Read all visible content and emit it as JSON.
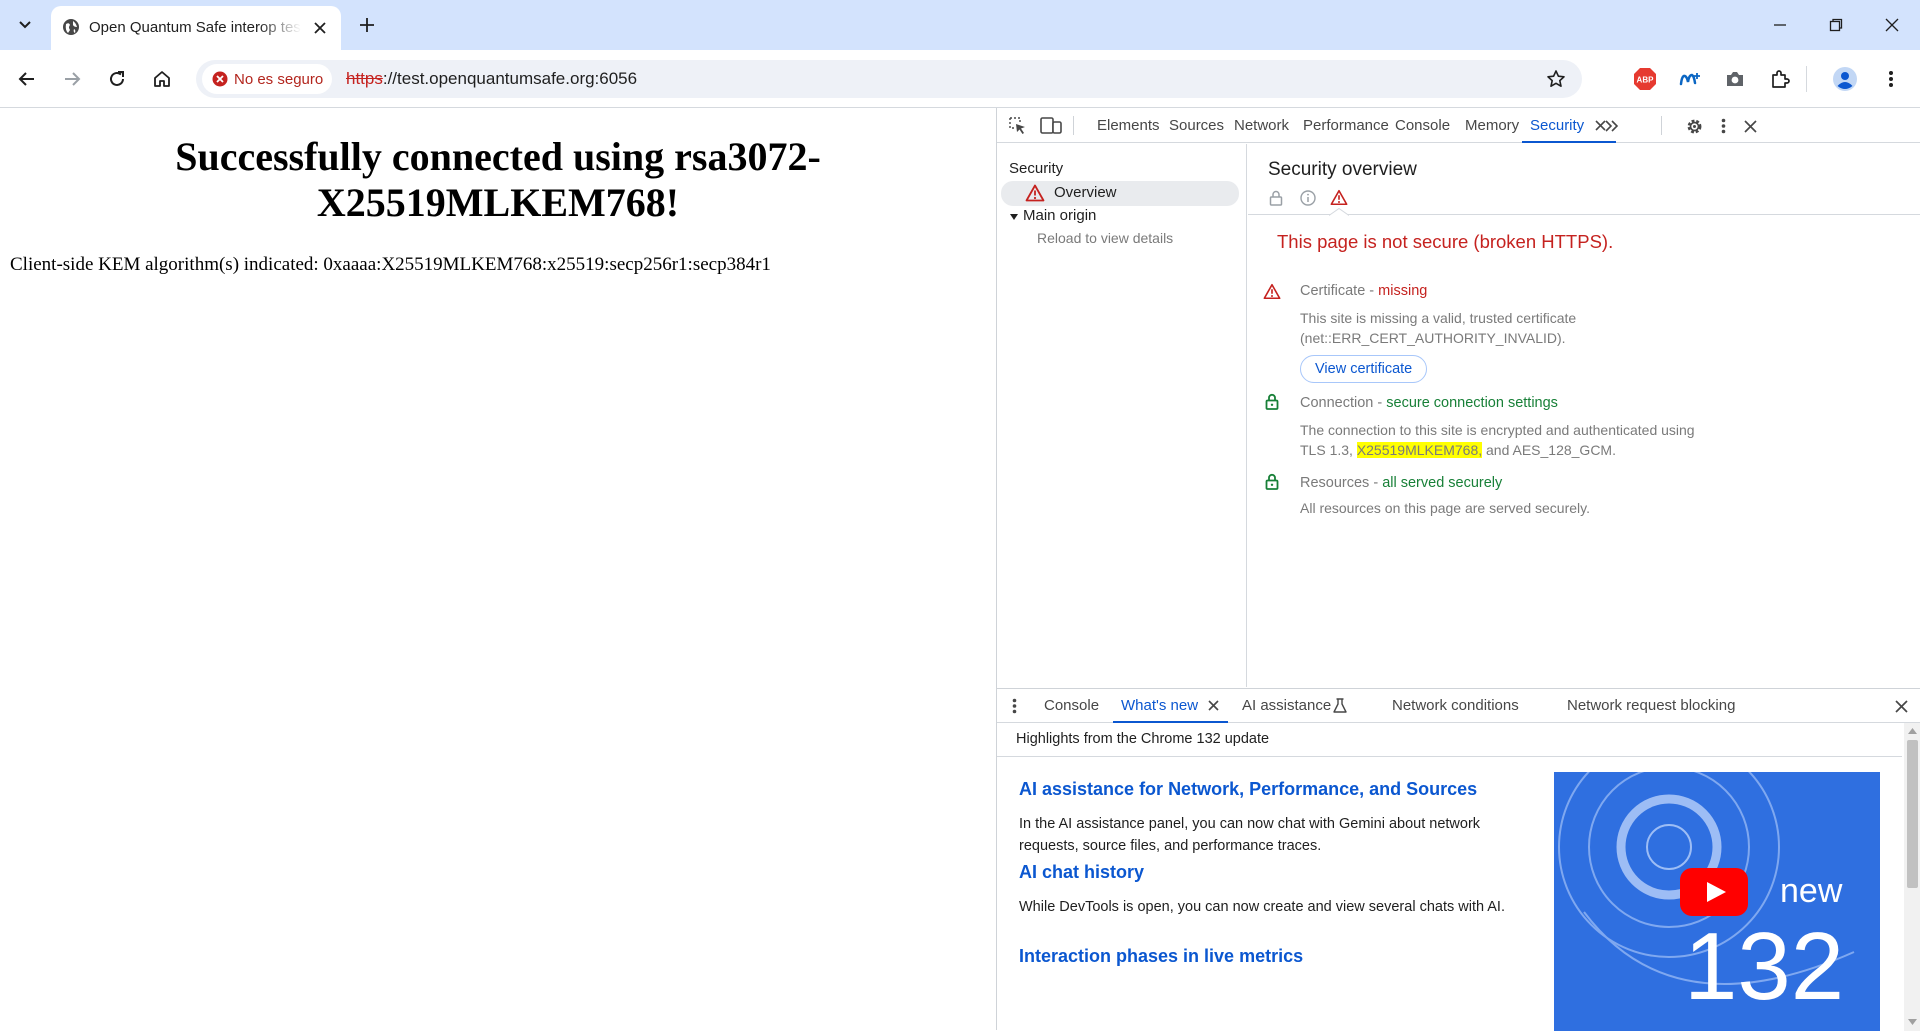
{
  "browser": {
    "tab_title": "Open Quantum Safe interop test",
    "security_chip": "No es seguro",
    "url_scheme": "https",
    "url_rest": "://test.openquantumsafe.org:6056",
    "extensions": {
      "abp": "ABP"
    }
  },
  "page": {
    "heading": "Successfully connected using rsa3072-X25519MLKEM768!",
    "kem_text": "Client-side KEM algorithm(s) indicated: 0xaaaa:X25519MLKEM768:x25519:secp256r1:secp384r1"
  },
  "devtools": {
    "tabs": [
      "Elements",
      "Sources",
      "Network",
      "Performance",
      "Console",
      "Memory",
      "Security"
    ],
    "active_tab": "Security",
    "sidebar": {
      "section": "Security",
      "overview": "Overview",
      "main_origin": "Main origin",
      "reload_hint": "Reload to view details"
    },
    "overview": {
      "title": "Security overview",
      "summary": "This page is not secure (broken HTTPS).",
      "certificate": {
        "label": "Certificate",
        "sep": " - ",
        "status": "missing",
        "desc": "This site is missing a valid, trusted certificate (net::ERR_CERT_AUTHORITY_INVALID).",
        "button": "View certificate"
      },
      "connection": {
        "label": "Connection",
        "sep": " - ",
        "status": "secure connection settings",
        "desc_before": "The connection to this site is encrypted and authenticated using TLS 1.3, ",
        "desc_highlight": "X25519MLKEM768,",
        "desc_after": " and AES_128_GCM."
      },
      "resources": {
        "label": "Resources",
        "sep": " - ",
        "status": "all served securely",
        "desc": "All resources on this page are served securely."
      }
    },
    "drawer": {
      "tabs": [
        "Console",
        "What's new",
        "AI assistance",
        "Network conditions",
        "Network request blocking"
      ],
      "active_tab": "What's new",
      "highlights": "Highlights from the Chrome 132 update",
      "items": [
        {
          "title": "AI assistance for Network, Performance, and Sources",
          "body": "In the AI assistance panel, you can now chat with Gemini about network requests, source files, and performance traces."
        },
        {
          "title": "AI chat history",
          "body": "While DevTools is open, you can now create and view several chats with AI."
        },
        {
          "title": "Interaction phases in live metrics",
          "body": ""
        }
      ],
      "thumbnail": {
        "word": "new",
        "version": "132"
      }
    }
  },
  "colors": {
    "accent": "#0b57d0",
    "danger": "#c5221f",
    "secure": "#188038",
    "highlight": "#ffff00",
    "tabstrip": "#d3e3fd"
  }
}
